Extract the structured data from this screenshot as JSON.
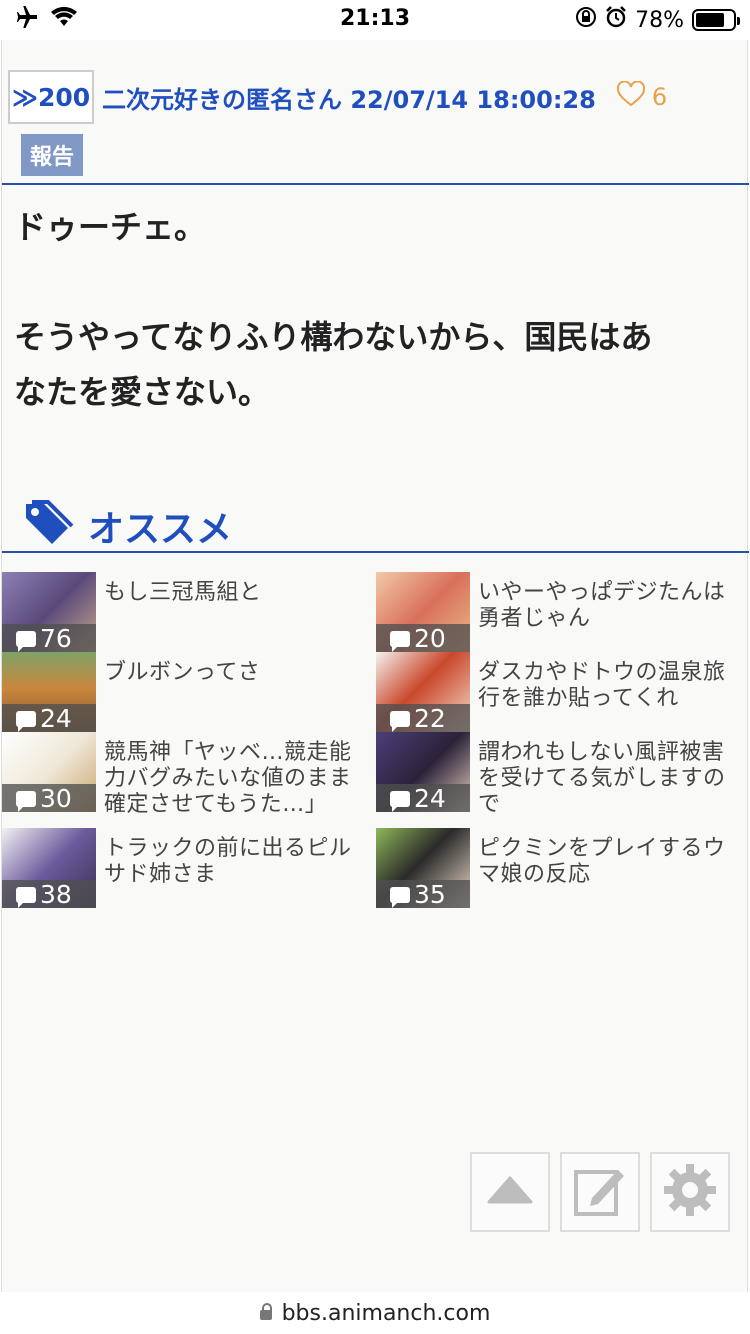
{
  "status_bar": {
    "time": "21:13",
    "battery": "78%",
    "airplane_icon": "airplane-icon",
    "wifi_icon": "wifi-icon"
  },
  "post": {
    "reply_number": "≫200",
    "author_datetime": "二次元好きの匿名さん 22/07/14 18:00:28",
    "likes": "6",
    "report_label": "報告",
    "body_line1": "ドゥーチェ。",
    "body_line2": "そうやってなりふり構わないから、国民はあ",
    "body_line3": "なたを愛さない。"
  },
  "recommend": {
    "title": "オススメ",
    "items": [
      {
        "title": "もし三冠馬組と",
        "count": "76",
        "color": "#6a5d8a"
      },
      {
        "title": "いやーやっぱデジたんは勇者じゃん",
        "count": "20",
        "color": "#d9a07a"
      },
      {
        "title": "ブルボンってさ",
        "count": "24",
        "color": "#b9803f"
      },
      {
        "title": "ダスカやドトウの温泉旅行を誰か貼ってくれ",
        "count": "22",
        "color": "#c4502e"
      },
      {
        "title": "競馬神「ヤッベ…競走能力バグみたいな値のまま確定させてもうた…」",
        "count": "30",
        "color": "#e9e4d8"
      },
      {
        "title": "謂われもしない風評被害を受けてる気がしますので",
        "count": "24",
        "color": "#3a3350"
      },
      {
        "title": "トラックの前に出るピルサド姉さま",
        "count": "38",
        "color": "#5b5f8c"
      },
      {
        "title": "ピクミンをプレイするウマ娘の反応",
        "count": "35",
        "color": "#4a5a3c"
      }
    ]
  },
  "url": "bbs.animanch.com"
}
